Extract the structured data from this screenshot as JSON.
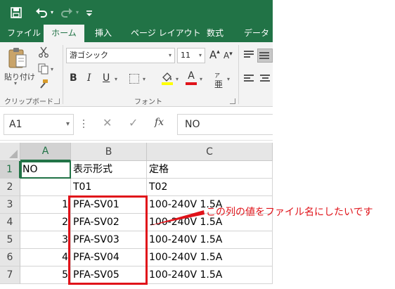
{
  "quick_access": {
    "save_icon": "save-icon",
    "undo_icon": "undo-icon",
    "redo_icon": "redo-icon",
    "customize_icon": "customize-icon"
  },
  "tabs": [
    {
      "label": "ファイル"
    },
    {
      "label": "ホーム",
      "active": true
    },
    {
      "label": "挿入"
    },
    {
      "label": "ページ レイアウト"
    },
    {
      "label": "数式"
    },
    {
      "label": "データ"
    }
  ],
  "ribbon": {
    "clipboard": {
      "paste_label": "貼り付け",
      "group_label": "クリップボード"
    },
    "font": {
      "font_name": "游ゴシック",
      "font_size": "11",
      "grow_label": "A",
      "shrink_label": "A",
      "bold_label": "B",
      "italic_label": "I",
      "underline_label": "U",
      "phonetic_label": "亜",
      "font_color_label": "A",
      "group_label": "フォント"
    }
  },
  "formula_bar": {
    "name_box": "A1",
    "fx_label": "fx",
    "value": "NO"
  },
  "colors": {
    "accent": "#217346",
    "annotation": "#e0131a",
    "highlight_fill": "#ffff00",
    "font_red": "#e0131a"
  },
  "grid": {
    "columns": [
      "A",
      "B",
      "C"
    ],
    "rows": [
      {
        "num": "1",
        "a": "NO",
        "b": "表示形式",
        "c": "定格"
      },
      {
        "num": "2",
        "a": "",
        "b": "T01",
        "c": "T02"
      },
      {
        "num": "3",
        "a": "1",
        "b": "PFA-SV01",
        "c": "100-240V 1.5A"
      },
      {
        "num": "4",
        "a": "2",
        "b": "PFA-SV02",
        "c": "100-240V 1.5A"
      },
      {
        "num": "5",
        "a": "3",
        "b": "PFA-SV03",
        "c": "100-240V 1.5A"
      },
      {
        "num": "6",
        "a": "4",
        "b": "PFA-SV04",
        "c": "100-240V 1.5A"
      },
      {
        "num": "7",
        "a": "5",
        "b": "PFA-SV05",
        "c": "100-240V 1.5A"
      }
    ]
  },
  "annotation": {
    "text": "この列の値をファイル名にしたいです"
  }
}
